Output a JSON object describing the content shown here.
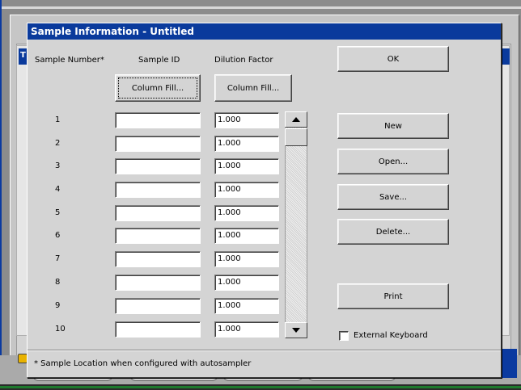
{
  "dialog": {
    "title": "Sample Information - Untitled",
    "columns": {
      "sample_number": "Sample Number*",
      "sample_id": "Sample ID",
      "dilution_factor": "Dilution Factor"
    },
    "column_fill_label": "Column Fill...",
    "rows": [
      {
        "num": "1",
        "sample_id": "",
        "dilution": "1.000"
      },
      {
        "num": "2",
        "sample_id": "",
        "dilution": "1.000"
      },
      {
        "num": "3",
        "sample_id": "",
        "dilution": "1.000"
      },
      {
        "num": "4",
        "sample_id": "",
        "dilution": "1.000"
      },
      {
        "num": "5",
        "sample_id": "",
        "dilution": "1.000"
      },
      {
        "num": "6",
        "sample_id": "",
        "dilution": "1.000"
      },
      {
        "num": "7",
        "sample_id": "",
        "dilution": "1.000"
      },
      {
        "num": "8",
        "sample_id": "",
        "dilution": "1.000"
      },
      {
        "num": "9",
        "sample_id": "",
        "dilution": "1.000"
      },
      {
        "num": "10",
        "sample_id": "",
        "dilution": "1.000"
      }
    ],
    "buttons": {
      "ok": "OK",
      "new": "New",
      "open": "Open...",
      "save": "Save...",
      "delete": "Delete...",
      "print": "Print"
    },
    "external_keyboard_label": "External Keyboard",
    "footnote": "* Sample Location when configured with autosampler"
  },
  "background": {
    "window_title_initial": "T"
  },
  "colors": {
    "titlebar": "#0a3a9c",
    "dialog_bg": "#d4d4d4"
  }
}
